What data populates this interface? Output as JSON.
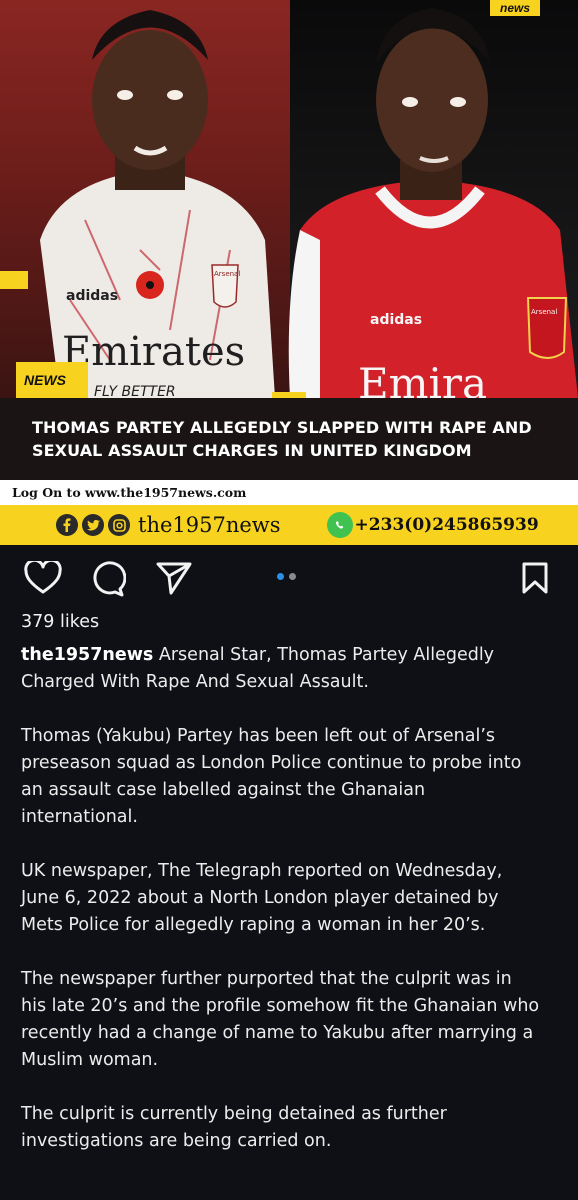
{
  "post_image": {
    "brand_badge": "news",
    "news_tag": "NEWS",
    "headline": "THOMAS PARTEY ALLEGEDLY SLAPPED WITH RAPE AND SEXUAL ASSAULT CHARGES IN UNITED KINGDOM",
    "jersey_left_sponsor": "Emirates",
    "jersey_left_small": "FLY BETTER",
    "jersey_right_sponsor": "Emira",
    "kit_brand": "adidas",
    "crest_text": "Arsenal",
    "logon_text": "Log On to www.the1957news.com",
    "social_handle": "the1957news",
    "phone": "+233(0)245865939",
    "icons": [
      "facebook-icon",
      "twitter-icon",
      "instagram-icon",
      "whatsapp-icon"
    ],
    "colors": {
      "accent_yellow": "#f7d21f",
      "headline_bg": "#1a1414"
    }
  },
  "actions": {
    "icons": [
      "heart-icon",
      "comment-icon",
      "share-icon",
      "bookmark-icon"
    ],
    "carousel": {
      "count": 2,
      "active": 0,
      "active_color": "#2b8fe8"
    }
  },
  "likes": "379 likes",
  "caption": {
    "username": "the1957news",
    "lead": "Arsenal Star, Thomas Partey Allegedly Charged With Rape And Sexual Assault.",
    "paragraphs": [
      "Thomas (Yakubu) Partey has been left out of Arsenal’s preseason squad as London Police continue to probe into an assault case labelled against the Ghanaian international.",
      "UK newspaper, The Telegraph reported on Wednesday, June 6, 2022 about a North London player detained by Mets Police for allegedly raping a woman in her 20’s.",
      "The newspaper further purported that the culprit was in his late 20’s and the profile somehow fit the Ghanaian who recently had a change of name to Yakubu after marrying a Muslim woman.",
      "The culprit is currently being detained as further investigations are being carried on."
    ]
  }
}
